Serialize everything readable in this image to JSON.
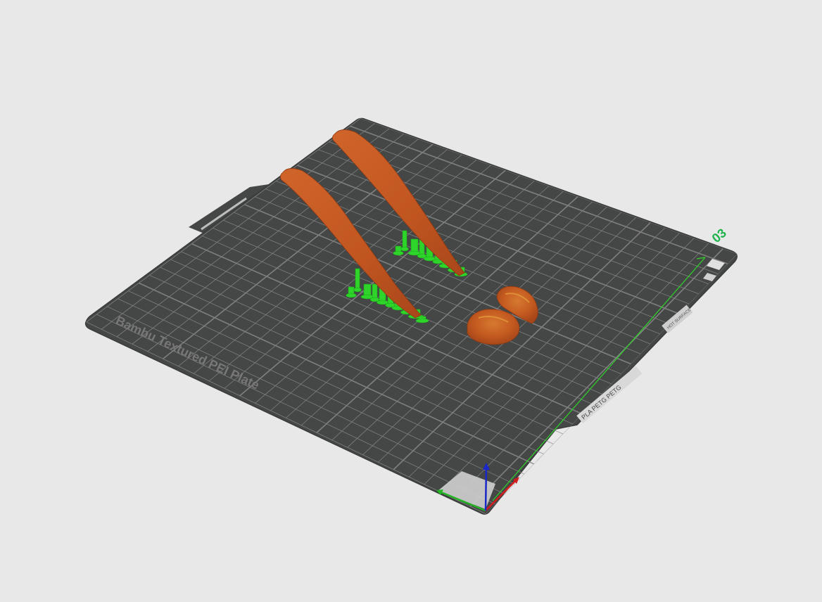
{
  "plate": {
    "brand_label": "Bambu Textured PEI Plate",
    "plate_number": "03",
    "filament_label": "PLA PETG PETG",
    "warning_label": "HOT SURFACE"
  },
  "colors": {
    "background": "#e8e8e8",
    "plate": "#454646",
    "grid": "#8a8a8a",
    "model": "#c55a22",
    "support": "#2fd42a",
    "plate_number": "#1db34a",
    "axis_x": "#d11d1d",
    "axis_y": "#23b323",
    "axis_z": "#1a27c8"
  },
  "scene": {
    "models": [
      "paddle-left",
      "paddle-right",
      "hemisphere-front",
      "hemisphere-back"
    ],
    "supports": [
      "support-left",
      "support-right"
    ]
  }
}
